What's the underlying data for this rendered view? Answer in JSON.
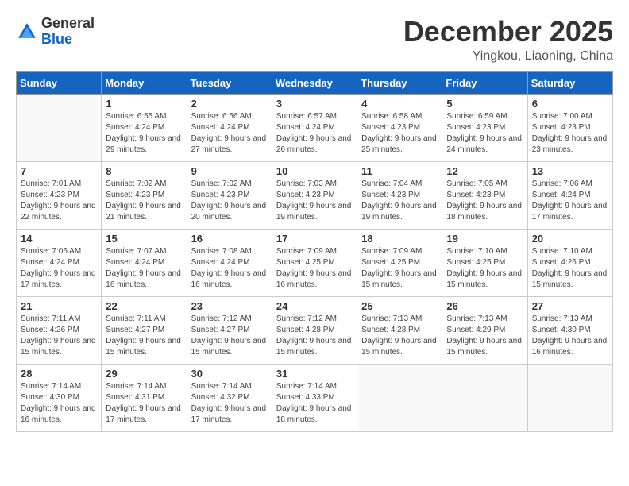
{
  "header": {
    "logo_general": "General",
    "logo_blue": "Blue",
    "month_title": "December 2025",
    "location": "Yingkou, Liaoning, China"
  },
  "weekdays": [
    "Sunday",
    "Monday",
    "Tuesday",
    "Wednesday",
    "Thursday",
    "Friday",
    "Saturday"
  ],
  "weeks": [
    [
      {
        "day": "",
        "sunrise": "",
        "sunset": "",
        "daylight": ""
      },
      {
        "day": "1",
        "sunrise": "Sunrise: 6:55 AM",
        "sunset": "Sunset: 4:24 PM",
        "daylight": "Daylight: 9 hours and 29 minutes."
      },
      {
        "day": "2",
        "sunrise": "Sunrise: 6:56 AM",
        "sunset": "Sunset: 4:24 PM",
        "daylight": "Daylight: 9 hours and 27 minutes."
      },
      {
        "day": "3",
        "sunrise": "Sunrise: 6:57 AM",
        "sunset": "Sunset: 4:24 PM",
        "daylight": "Daylight: 9 hours and 26 minutes."
      },
      {
        "day": "4",
        "sunrise": "Sunrise: 6:58 AM",
        "sunset": "Sunset: 4:23 PM",
        "daylight": "Daylight: 9 hours and 25 minutes."
      },
      {
        "day": "5",
        "sunrise": "Sunrise: 6:59 AM",
        "sunset": "Sunset: 4:23 PM",
        "daylight": "Daylight: 9 hours and 24 minutes."
      },
      {
        "day": "6",
        "sunrise": "Sunrise: 7:00 AM",
        "sunset": "Sunset: 4:23 PM",
        "daylight": "Daylight: 9 hours and 23 minutes."
      }
    ],
    [
      {
        "day": "7",
        "sunrise": "Sunrise: 7:01 AM",
        "sunset": "Sunset: 4:23 PM",
        "daylight": "Daylight: 9 hours and 22 minutes."
      },
      {
        "day": "8",
        "sunrise": "Sunrise: 7:02 AM",
        "sunset": "Sunset: 4:23 PM",
        "daylight": "Daylight: 9 hours and 21 minutes."
      },
      {
        "day": "9",
        "sunrise": "Sunrise: 7:02 AM",
        "sunset": "Sunset: 4:23 PM",
        "daylight": "Daylight: 9 hours and 20 minutes."
      },
      {
        "day": "10",
        "sunrise": "Sunrise: 7:03 AM",
        "sunset": "Sunset: 4:23 PM",
        "daylight": "Daylight: 9 hours and 19 minutes."
      },
      {
        "day": "11",
        "sunrise": "Sunrise: 7:04 AM",
        "sunset": "Sunset: 4:23 PM",
        "daylight": "Daylight: 9 hours and 19 minutes."
      },
      {
        "day": "12",
        "sunrise": "Sunrise: 7:05 AM",
        "sunset": "Sunset: 4:23 PM",
        "daylight": "Daylight: 9 hours and 18 minutes."
      },
      {
        "day": "13",
        "sunrise": "Sunrise: 7:06 AM",
        "sunset": "Sunset: 4:24 PM",
        "daylight": "Daylight: 9 hours and 17 minutes."
      }
    ],
    [
      {
        "day": "14",
        "sunrise": "Sunrise: 7:06 AM",
        "sunset": "Sunset: 4:24 PM",
        "daylight": "Daylight: 9 hours and 17 minutes."
      },
      {
        "day": "15",
        "sunrise": "Sunrise: 7:07 AM",
        "sunset": "Sunset: 4:24 PM",
        "daylight": "Daylight: 9 hours and 16 minutes."
      },
      {
        "day": "16",
        "sunrise": "Sunrise: 7:08 AM",
        "sunset": "Sunset: 4:24 PM",
        "daylight": "Daylight: 9 hours and 16 minutes."
      },
      {
        "day": "17",
        "sunrise": "Sunrise: 7:09 AM",
        "sunset": "Sunset: 4:25 PM",
        "daylight": "Daylight: 9 hours and 16 minutes."
      },
      {
        "day": "18",
        "sunrise": "Sunrise: 7:09 AM",
        "sunset": "Sunset: 4:25 PM",
        "daylight": "Daylight: 9 hours and 15 minutes."
      },
      {
        "day": "19",
        "sunrise": "Sunrise: 7:10 AM",
        "sunset": "Sunset: 4:25 PM",
        "daylight": "Daylight: 9 hours and 15 minutes."
      },
      {
        "day": "20",
        "sunrise": "Sunrise: 7:10 AM",
        "sunset": "Sunset: 4:26 PM",
        "daylight": "Daylight: 9 hours and 15 minutes."
      }
    ],
    [
      {
        "day": "21",
        "sunrise": "Sunrise: 7:11 AM",
        "sunset": "Sunset: 4:26 PM",
        "daylight": "Daylight: 9 hours and 15 minutes."
      },
      {
        "day": "22",
        "sunrise": "Sunrise: 7:11 AM",
        "sunset": "Sunset: 4:27 PM",
        "daylight": "Daylight: 9 hours and 15 minutes."
      },
      {
        "day": "23",
        "sunrise": "Sunrise: 7:12 AM",
        "sunset": "Sunset: 4:27 PM",
        "daylight": "Daylight: 9 hours and 15 minutes."
      },
      {
        "day": "24",
        "sunrise": "Sunrise: 7:12 AM",
        "sunset": "Sunset: 4:28 PM",
        "daylight": "Daylight: 9 hours and 15 minutes."
      },
      {
        "day": "25",
        "sunrise": "Sunrise: 7:13 AM",
        "sunset": "Sunset: 4:28 PM",
        "daylight": "Daylight: 9 hours and 15 minutes."
      },
      {
        "day": "26",
        "sunrise": "Sunrise: 7:13 AM",
        "sunset": "Sunset: 4:29 PM",
        "daylight": "Daylight: 9 hours and 15 minutes."
      },
      {
        "day": "27",
        "sunrise": "Sunrise: 7:13 AM",
        "sunset": "Sunset: 4:30 PM",
        "daylight": "Daylight: 9 hours and 16 minutes."
      }
    ],
    [
      {
        "day": "28",
        "sunrise": "Sunrise: 7:14 AM",
        "sunset": "Sunset: 4:30 PM",
        "daylight": "Daylight: 9 hours and 16 minutes."
      },
      {
        "day": "29",
        "sunrise": "Sunrise: 7:14 AM",
        "sunset": "Sunset: 4:31 PM",
        "daylight": "Daylight: 9 hours and 17 minutes."
      },
      {
        "day": "30",
        "sunrise": "Sunrise: 7:14 AM",
        "sunset": "Sunset: 4:32 PM",
        "daylight": "Daylight: 9 hours and 17 minutes."
      },
      {
        "day": "31",
        "sunrise": "Sunrise: 7:14 AM",
        "sunset": "Sunset: 4:33 PM",
        "daylight": "Daylight: 9 hours and 18 minutes."
      },
      {
        "day": "",
        "sunrise": "",
        "sunset": "",
        "daylight": ""
      },
      {
        "day": "",
        "sunrise": "",
        "sunset": "",
        "daylight": ""
      },
      {
        "day": "",
        "sunrise": "",
        "sunset": "",
        "daylight": ""
      }
    ]
  ]
}
